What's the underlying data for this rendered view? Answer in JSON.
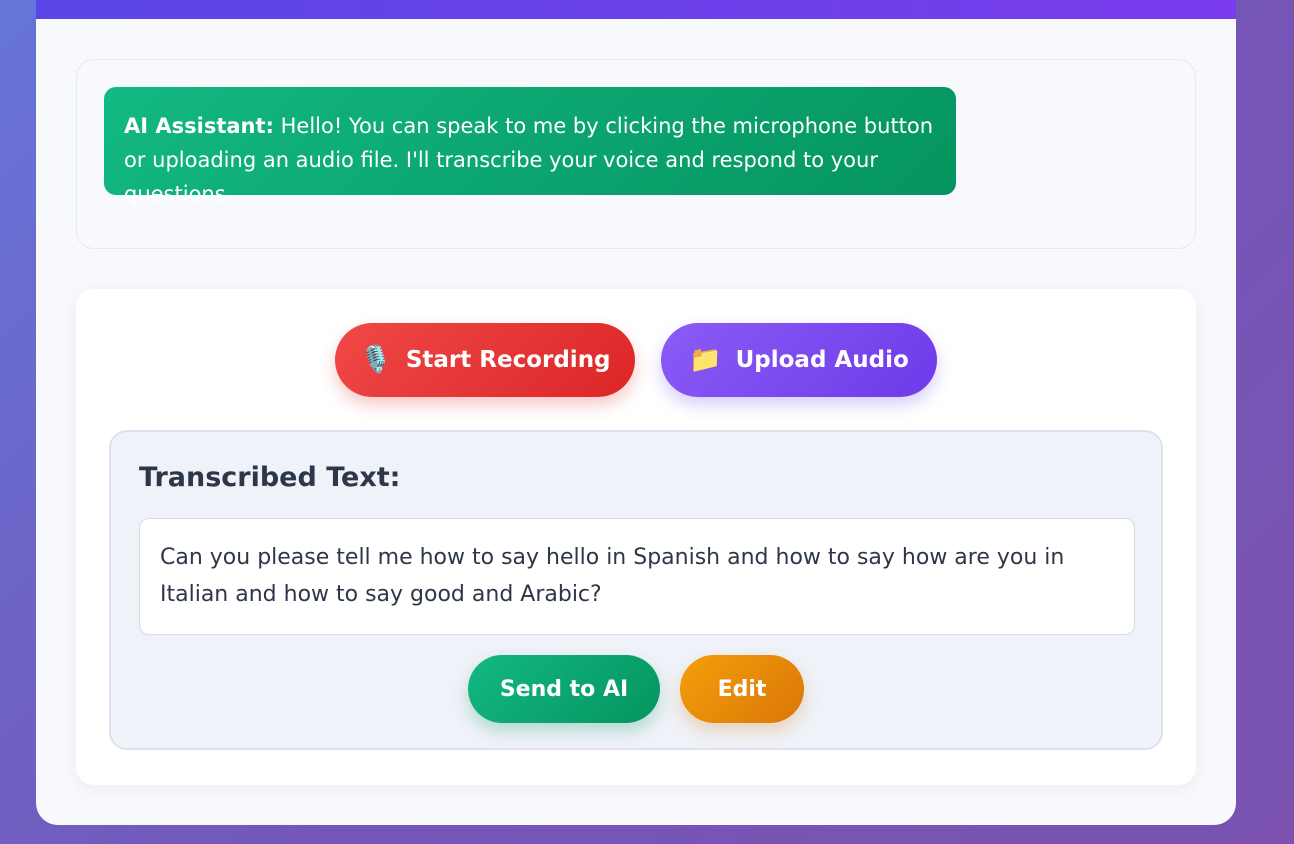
{
  "chat": {
    "ai_message": {
      "speaker": "AI Assistant:",
      "text": " Hello! You can speak to me by clicking the microphone button or uploading an audio file. I'll transcribe your voice and respond to your questions."
    }
  },
  "controls": {
    "record": {
      "icon": "🎙️",
      "icon_name": "microphone-icon",
      "label": "Start Recording"
    },
    "upload": {
      "icon": "📁",
      "icon_name": "folder-icon",
      "label": "Upload Audio"
    }
  },
  "transcript": {
    "heading": "Transcribed Text:",
    "text": "Can you please tell me how to say hello in Spanish and how to say how are you in Italian and how to say good and Arabic?",
    "send_label": "Send to AI",
    "edit_label": "Edit"
  },
  "colors": {
    "header_bar": "#6a40ea",
    "ai_bubble": "#0ea572",
    "record": "#e53a3a",
    "upload": "#7c4af0",
    "send": "#0ea572",
    "edit": "#e88a08"
  }
}
